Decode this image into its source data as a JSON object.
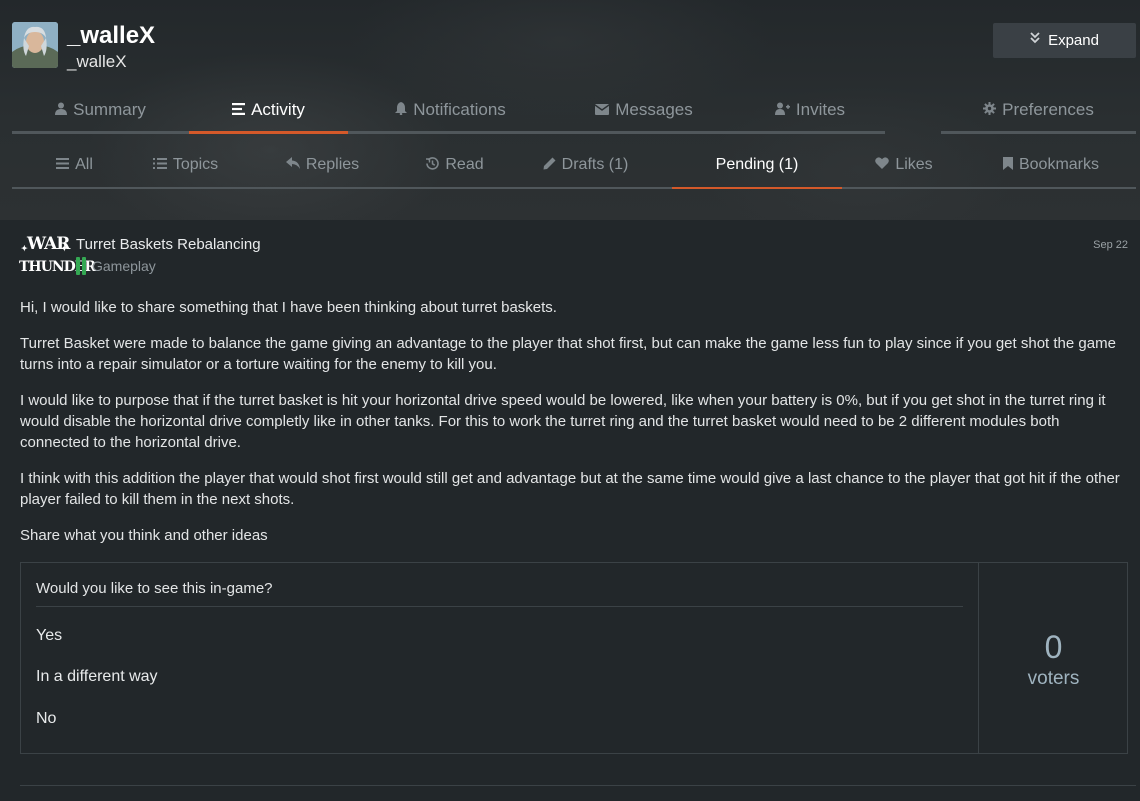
{
  "profile": {
    "username": "_walleX",
    "subname": "_walleX",
    "expand_label": "Expand"
  },
  "nav": {
    "tabs": [
      {
        "label": "Summary",
        "icon": "user-icon"
      },
      {
        "label": "Activity",
        "icon": "list-icon",
        "active": true
      },
      {
        "label": "Notifications",
        "icon": "bell-icon"
      },
      {
        "label": "Messages",
        "icon": "envelope-icon"
      },
      {
        "label": "Invites",
        "icon": "user-plus-icon"
      },
      {
        "label": "Preferences",
        "icon": "gear-icon"
      }
    ]
  },
  "subnav": {
    "tabs": [
      {
        "label": "All",
        "icon": "list-icon"
      },
      {
        "label": "Topics",
        "icon": "list-ul-icon"
      },
      {
        "label": "Replies",
        "icon": "reply-icon"
      },
      {
        "label": "Read",
        "icon": "history-icon"
      },
      {
        "label": "Drafts (1)",
        "icon": "pencil-icon"
      },
      {
        "label": "Pending (1)",
        "icon": "",
        "active": true
      },
      {
        "label": "Likes",
        "icon": "heart-icon"
      },
      {
        "label": "Bookmarks",
        "icon": "bookmark-icon"
      }
    ]
  },
  "post": {
    "logo_line1": "WAR",
    "logo_line2": "THUNDER",
    "title": "Turret Baskets Rebalancing",
    "category": "Gameplay",
    "category_color": "#34a853",
    "date": "Sep 22",
    "paragraphs": [
      "Hi, I would like to share something that I have been thinking about turret baskets.",
      "Turret Basket were made to balance the game giving an advantage to the player that shot first, but can make the game less fun to play since if you get shot the game turns into a repair simulator or a torture waiting for the enemy to kill you.",
      "I would like to purpose that if the turret basket is hit your horizontal drive speed would be lowered, like when your battery is 0%, but if you get shot in the turret ring it would disable the horizontal drive completly like in other tanks. For this to work the turret ring and the turret basket would need to be 2 different modules both connected to the horizontal drive.",
      "I think with this addition the player that would shot first would still get and advantage but at the same time would give a last chance to the player that got hit if the other player failed to kill them in the next shots.",
      "Share what you think and other ideas"
    ]
  },
  "poll": {
    "question": "Would you like to see this in-game?",
    "options": [
      "Yes",
      "In a different way",
      "No"
    ],
    "voter_count": "0",
    "voter_label": "voters"
  },
  "colors": {
    "accent": "#d4592a",
    "background": "#22272a",
    "category": "#34a853"
  }
}
